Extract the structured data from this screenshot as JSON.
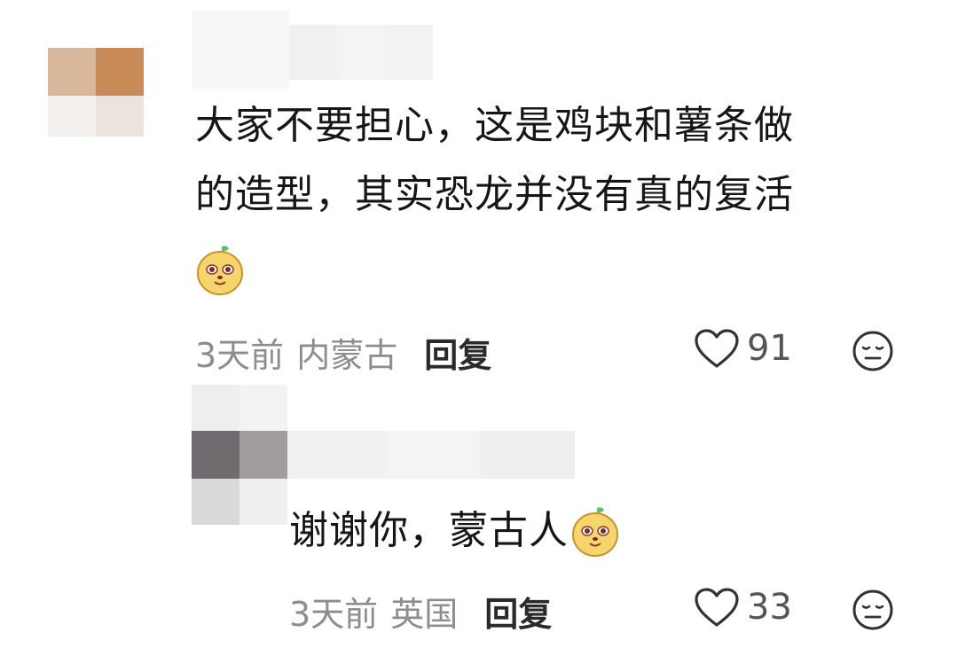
{
  "comments": [
    {
      "text_line1": "大家不要担心，这是鸡块和薯条做",
      "text_line2": "的造型，其实恐龙并没有真的复活",
      "emoji": "potato-face-emoji",
      "time": "3天前",
      "location": "内蒙古",
      "reply_label": "回复",
      "likes": "91"
    },
    {
      "text": "谢谢你，蒙古人",
      "emoji": "potato-face-emoji",
      "time": "3天前",
      "location": "英国",
      "reply_label": "回复",
      "likes": "33"
    }
  ],
  "icons": {
    "like": "heart-outline-icon",
    "dislike": "meh-face-icon"
  }
}
